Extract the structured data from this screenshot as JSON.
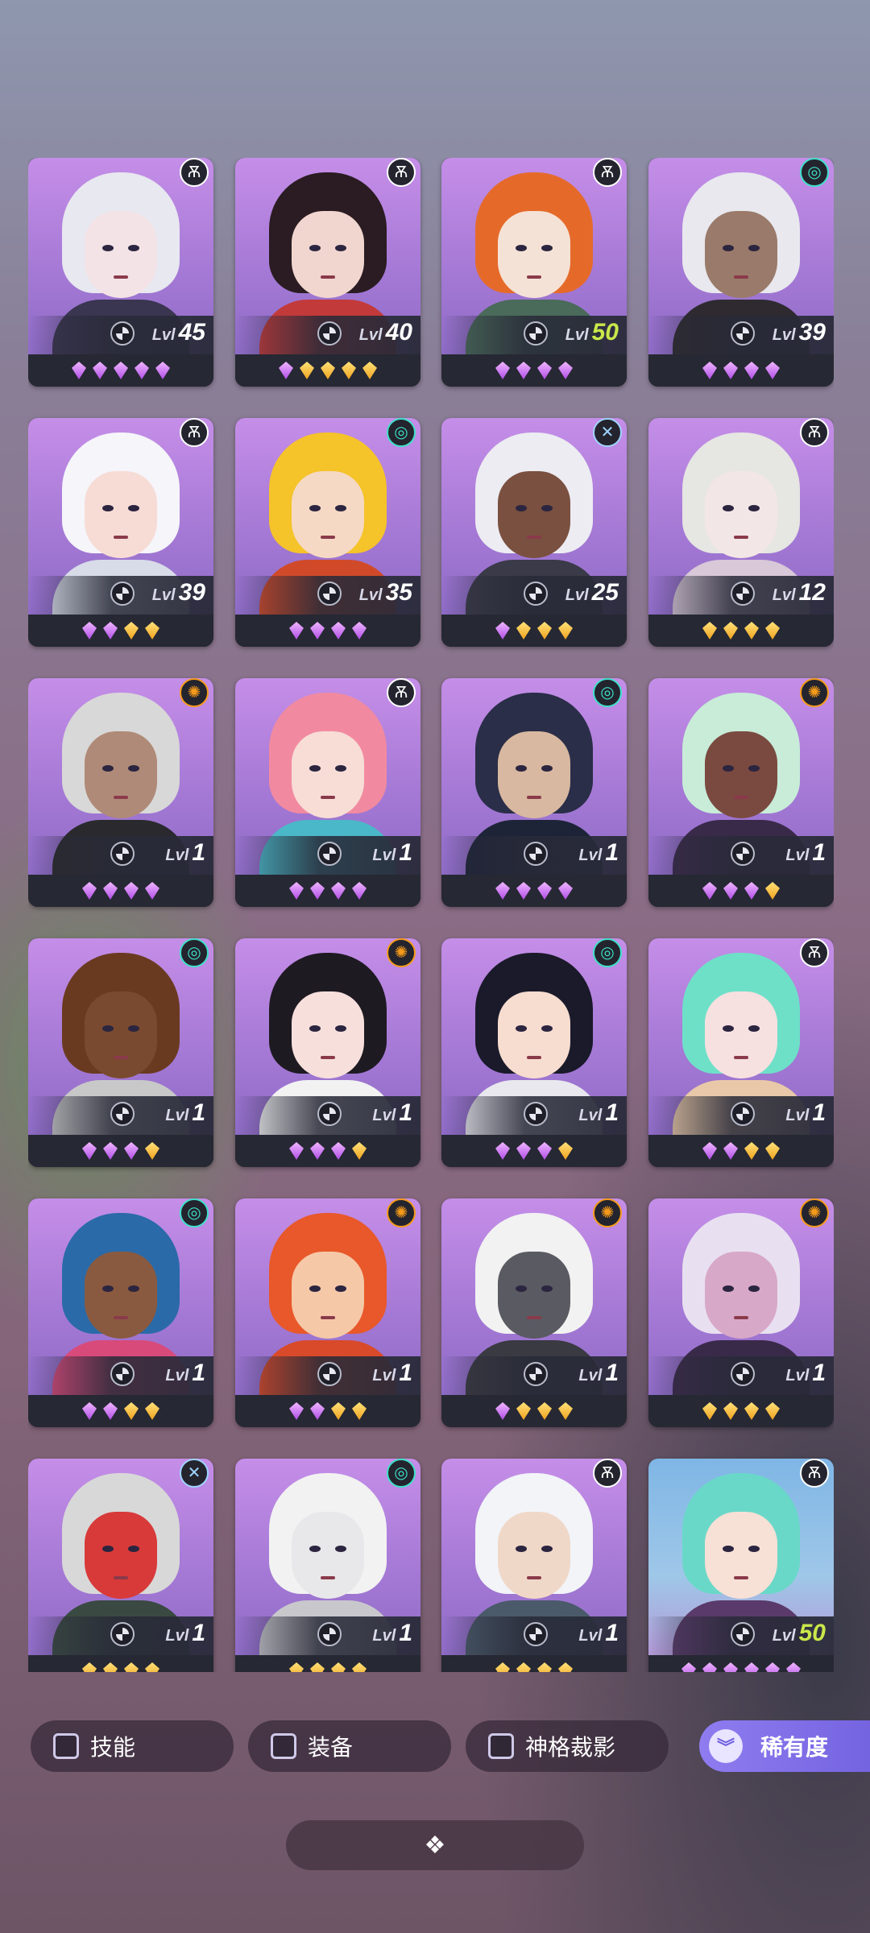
{
  "level_label": "Lvl",
  "heroes": [
    {
      "level": "45",
      "faction": "dark",
      "gems": "ppppp",
      "hair": "#e8e8f0",
      "skin": "#f3e3e6",
      "cloth": "#3a3550",
      "bg": "purple"
    },
    {
      "level": "40",
      "faction": "dark",
      "gems": "pgggg",
      "hair": "#2a1c22",
      "skin": "#f1d6cf",
      "cloth": "#c23a3a",
      "bg": "purple"
    },
    {
      "level": "50",
      "faction": "dark",
      "gems": "pppp",
      "hair": "#e56a2a",
      "skin": "#f5e2d6",
      "cloth": "#4a6a5a",
      "bg": "purple",
      "max": true
    },
    {
      "level": "39",
      "faction": "wind",
      "gems": "pppp",
      "hair": "#e8e8ee",
      "skin": "#9a7a6a",
      "cloth": "#2e2a30",
      "bg": "purple"
    },
    {
      "level": "39",
      "faction": "dark",
      "gems": "ppgg",
      "hair": "#f5f5fa",
      "skin": "#f7dcd6",
      "cloth": "#d8dce8",
      "bg": "purple"
    },
    {
      "level": "35",
      "faction": "wind",
      "gems": "pppp",
      "hair": "#f5c32a",
      "skin": "#f5d9c4",
      "cloth": "#d04a2a",
      "bg": "purple"
    },
    {
      "level": "25",
      "faction": "cross",
      "gems": "pggg",
      "hair": "#ececf2",
      "skin": "#7a5040",
      "cloth": "#3a3a48",
      "bg": "purple"
    },
    {
      "level": "12",
      "faction": "dark",
      "gems": "gggg",
      "hair": "#e6e6e2",
      "skin": "#f3e6e6",
      "cloth": "#d8c8d8",
      "bg": "purple"
    },
    {
      "level": "1",
      "faction": "fire",
      "gems": "pppp",
      "hair": "#d8d8d8",
      "skin": "#b08a78",
      "cloth": "#2a2a2e",
      "bg": "purple"
    },
    {
      "level": "1",
      "faction": "dark",
      "gems": "pppp",
      "hair": "#f18aa0",
      "skin": "#f7ddd6",
      "cloth": "#4ab8c8",
      "bg": "purple"
    },
    {
      "level": "1",
      "faction": "wind",
      "gems": "pppp",
      "hair": "#2a2e48",
      "skin": "#d8b8a0",
      "cloth": "#1e2438",
      "bg": "purple"
    },
    {
      "level": "1",
      "faction": "fire",
      "gems": "pppg",
      "hair": "#c8ecd8",
      "skin": "#7a4a40",
      "cloth": "#3a2a4a",
      "bg": "purple"
    },
    {
      "level": "1",
      "faction": "wind",
      "gems": "pppg",
      "hair": "#6a3a20",
      "skin": "#7a4a30",
      "cloth": "#c8c8c8",
      "bg": "purple"
    },
    {
      "level": "1",
      "faction": "fire",
      "gems": "pppg",
      "hair": "#1e1a22",
      "skin": "#f7e0dc",
      "cloth": "#f2f2f2",
      "bg": "purple"
    },
    {
      "level": "1",
      "faction": "wind",
      "gems": "pppg",
      "hair": "#1a1a2a",
      "skin": "#f7dcd0",
      "cloth": "#e8e8ee",
      "bg": "purple"
    },
    {
      "level": "1",
      "faction": "dark",
      "gems": "ppgg",
      "hair": "#6ee0c8",
      "skin": "#f7e0e0",
      "cloth": "#e8c8a8",
      "bg": "purple"
    },
    {
      "level": "1",
      "faction": "wind",
      "gems": "ppgg",
      "hair": "#2a6aa8",
      "skin": "#8a5a40",
      "cloth": "#d84a7a",
      "bg": "purple"
    },
    {
      "level": "1",
      "faction": "fire",
      "gems": "ppgg",
      "hair": "#e8582a",
      "skin": "#f5c8a8",
      "cloth": "#d84a2a",
      "bg": "purple"
    },
    {
      "level": "1",
      "faction": "fire",
      "gems": "pggg",
      "hair": "#f2f2f2",
      "skin": "#5a5a62",
      "cloth": "#3a3a42",
      "bg": "purple"
    },
    {
      "level": "1",
      "faction": "fire",
      "gems": "gggg",
      "hair": "#e8e0f0",
      "skin": "#d8a8c8",
      "cloth": "#3a2a4a",
      "bg": "purple"
    },
    {
      "level": "1",
      "faction": "cross",
      "gems": "gggg",
      "hair": "#d8d8d8",
      "skin": "#d83a3a",
      "cloth": "#3a4a42",
      "bg": "purple"
    },
    {
      "level": "1",
      "faction": "wind",
      "gems": "gggg",
      "hair": "#f2f2f2",
      "skin": "#e8e8ea",
      "cloth": "#c8c8cc",
      "bg": "purple"
    },
    {
      "level": "1",
      "faction": "dark",
      "gems": "gggg",
      "hair": "#f2f4f8",
      "skin": "#f0d8c8",
      "cloth": "#4a5a6a",
      "bg": "purple"
    },
    {
      "level": "50",
      "faction": "dark",
      "gems": "pppppp",
      "hair": "#6ad8c8",
      "skin": "#f7e0d6",
      "cloth": "#5a3a6a",
      "bg": "sky",
      "max": true
    }
  ],
  "filters": {
    "skill": "技能",
    "equipment": "装备",
    "divine": "神格裁影",
    "rarity": "稀有度"
  },
  "colors": {
    "accent": "#7c6ce6",
    "max_level": "#c9e84a"
  }
}
